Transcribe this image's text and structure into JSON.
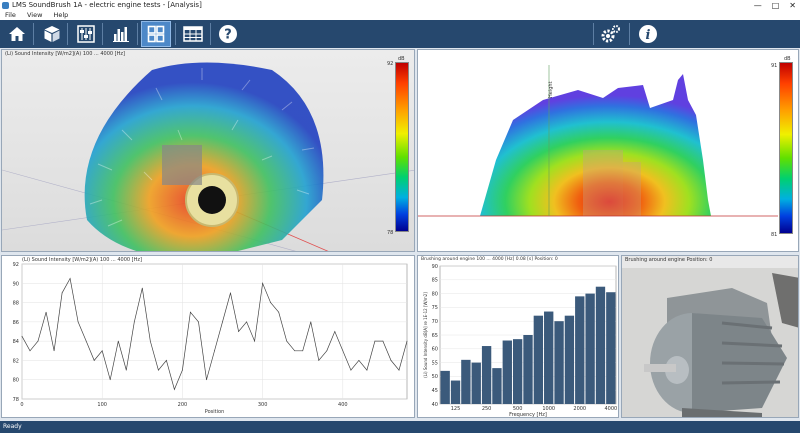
{
  "window": {
    "title": "LMS SoundBrush 1A - electric engine tests - [Analysis]",
    "minimize": "—",
    "maximize": "□",
    "close": "✕"
  },
  "menu": [
    "File",
    "View",
    "Help"
  ],
  "toolbar": {
    "left": [
      "home-icon",
      "cube-icon",
      "sliders-icon",
      "bar-chart-icon",
      "layout-grid-icon",
      "table-icon",
      "help-icon"
    ],
    "active": "layout-grid-icon",
    "right": [
      "settings-icon",
      "info-icon"
    ]
  },
  "panel3d": {
    "title": "(Li) Sound Intensity [W/m2](A)   100 ... 4000 [Hz]",
    "scale_unit": "dB",
    "scale_max": "92",
    "scale_min": "78"
  },
  "panelMap": {
    "scale_unit": "dB",
    "scale_max": "91",
    "scale_min": "81",
    "axis_label": "Height"
  },
  "panelLine": {
    "title": "(Li) Sound Intensity [W/m2](A)   100 ... 4000 [Hz]",
    "xlabel": "Position",
    "y_ticks": [
      "92",
      "90",
      "88",
      "86",
      "84",
      "82",
      "80",
      "78"
    ],
    "x_ticks": [
      "0",
      "100",
      "200",
      "300",
      "400"
    ]
  },
  "panelBar": {
    "title": "Brushing around engine   100 ... 4000 [Hz]   0.08 [s]   Position: 0",
    "xlabel": "Frequency [Hz]",
    "ylabel": "(Li) Sound Intensity  dB[A] re 1E-12 [W/m2]",
    "y_ticks": [
      "90",
      "85",
      "80",
      "75",
      "70",
      "65",
      "60",
      "55",
      "50",
      "45",
      "40"
    ],
    "x_ticks": [
      "125",
      "250",
      "500",
      "1000",
      "2000",
      "4000"
    ]
  },
  "panelPhoto": {
    "title": "Brushing around engine   Position: 0"
  },
  "status": "Ready",
  "chart_data": [
    {
      "type": "line",
      "title": "(Li) Sound Intensity [W/m2](A)   100 ... 4000 [Hz]",
      "xlabel": "Position",
      "ylabel": "",
      "xlim": [
        0,
        480
      ],
      "ylim": [
        78,
        92
      ],
      "grid": true,
      "x": [
        0,
        10,
        20,
        30,
        40,
        50,
        60,
        70,
        80,
        90,
        100,
        110,
        120,
        130,
        140,
        150,
        160,
        170,
        180,
        190,
        200,
        210,
        220,
        230,
        240,
        250,
        260,
        270,
        280,
        290,
        300,
        310,
        320,
        330,
        340,
        350,
        360,
        370,
        380,
        390,
        400,
        410,
        420,
        430,
        440,
        450,
        460,
        470,
        480
      ],
      "values": [
        84.5,
        83,
        84,
        87,
        83,
        89,
        90.5,
        86,
        84,
        82,
        83,
        80,
        84,
        81,
        86,
        89.5,
        84,
        81,
        82,
        79,
        81,
        87,
        86,
        80,
        83,
        86,
        89,
        85,
        86,
        84,
        90,
        88,
        87,
        84,
        83,
        83,
        86,
        82,
        83,
        85,
        83,
        81,
        82,
        81,
        84,
        84,
        82,
        81,
        84
      ]
    },
    {
      "type": "bar",
      "title": "Brushing around engine   100 ... 4000 [Hz]   0.08 [s]   Position: 0",
      "xlabel": "Frequency [Hz]",
      "ylabel": "(Li) Sound Intensity  dB[A] re 1E-12 [W/m2]",
      "ylim": [
        40,
        90
      ],
      "x_ticks": [
        "125",
        "250",
        "500",
        "1000",
        "2000",
        "4000"
      ],
      "categories": [
        "100",
        "125",
        "160",
        "200",
        "250",
        "315",
        "400",
        "500",
        "630",
        "800",
        "1000",
        "1250",
        "1600",
        "2000",
        "2500",
        "3150",
        "4000"
      ],
      "values": [
        52,
        48.5,
        56,
        55,
        61,
        53,
        63,
        63.5,
        65,
        72,
        73.5,
        70,
        72,
        79,
        80,
        82.5,
        80.5
      ]
    }
  ]
}
